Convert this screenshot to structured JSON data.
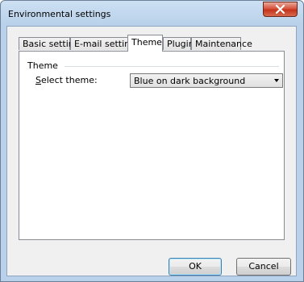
{
  "window": {
    "title": "Environmental settings"
  },
  "tabs": [
    {
      "label": "Basic settings",
      "active": false
    },
    {
      "label": "E-mail settings",
      "active": false
    },
    {
      "label": "Theme",
      "active": true
    },
    {
      "label": "Plugin",
      "active": false
    },
    {
      "label": "Maintenance",
      "active": false
    }
  ],
  "theme_panel": {
    "group_label": "Theme",
    "select_label_accel": "S",
    "select_label_rest": "elect theme:",
    "select_value": "Blue on dark background"
  },
  "buttons": {
    "ok": "OK",
    "cancel": "Cancel"
  },
  "colors": {
    "frame": "#b9d1ea",
    "client": "#f0f0f0",
    "close_button": "#c4331b",
    "default_button_border": "#3c7fb1"
  }
}
